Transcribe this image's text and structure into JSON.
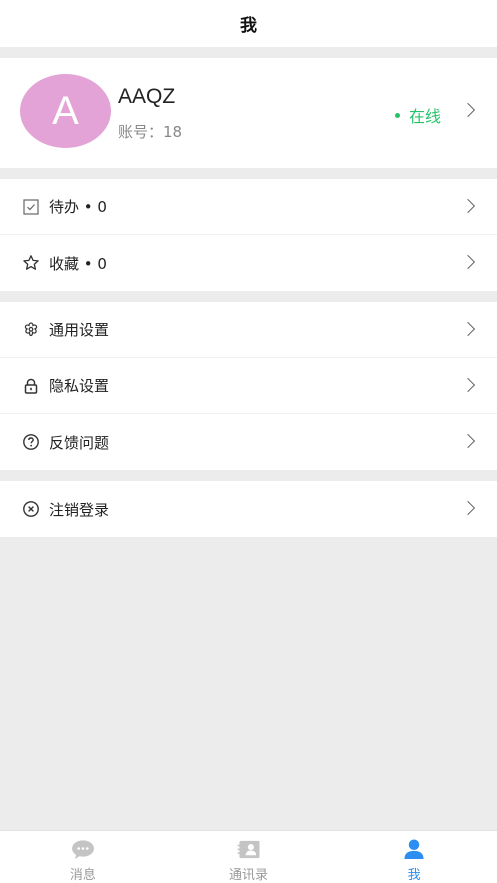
{
  "header": {
    "title": "我"
  },
  "profile": {
    "avatar_letter": "A",
    "name": "AAQZ",
    "account": "账号：18",
    "status": "在线"
  },
  "groups": [
    [
      {
        "label": "待办 • 0",
        "icon": "checkbox-icon"
      },
      {
        "label": "收藏 • 0",
        "icon": "star-icon"
      }
    ],
    [
      {
        "label": "通用设置",
        "icon": "settings-flower-icon"
      },
      {
        "label": "隐私设置",
        "icon": "lock-icon"
      },
      {
        "label": "反馈问题",
        "icon": "question-circle-icon"
      }
    ],
    [
      {
        "label": "注销登录",
        "icon": "close-circle-icon"
      }
    ]
  ],
  "tabs": [
    {
      "label": "消息",
      "icon": "chat-bubble-icon",
      "active": false
    },
    {
      "label": "通讯录",
      "icon": "contact-card-icon",
      "active": false
    },
    {
      "label": "我",
      "icon": "person-icon",
      "active": true
    }
  ],
  "colors": {
    "avatar": "#e3a3d6",
    "online": "#27c36b",
    "tab_active": "#2b8ef0",
    "tab_inactive": "#bbbbbb",
    "background": "#ececec"
  }
}
